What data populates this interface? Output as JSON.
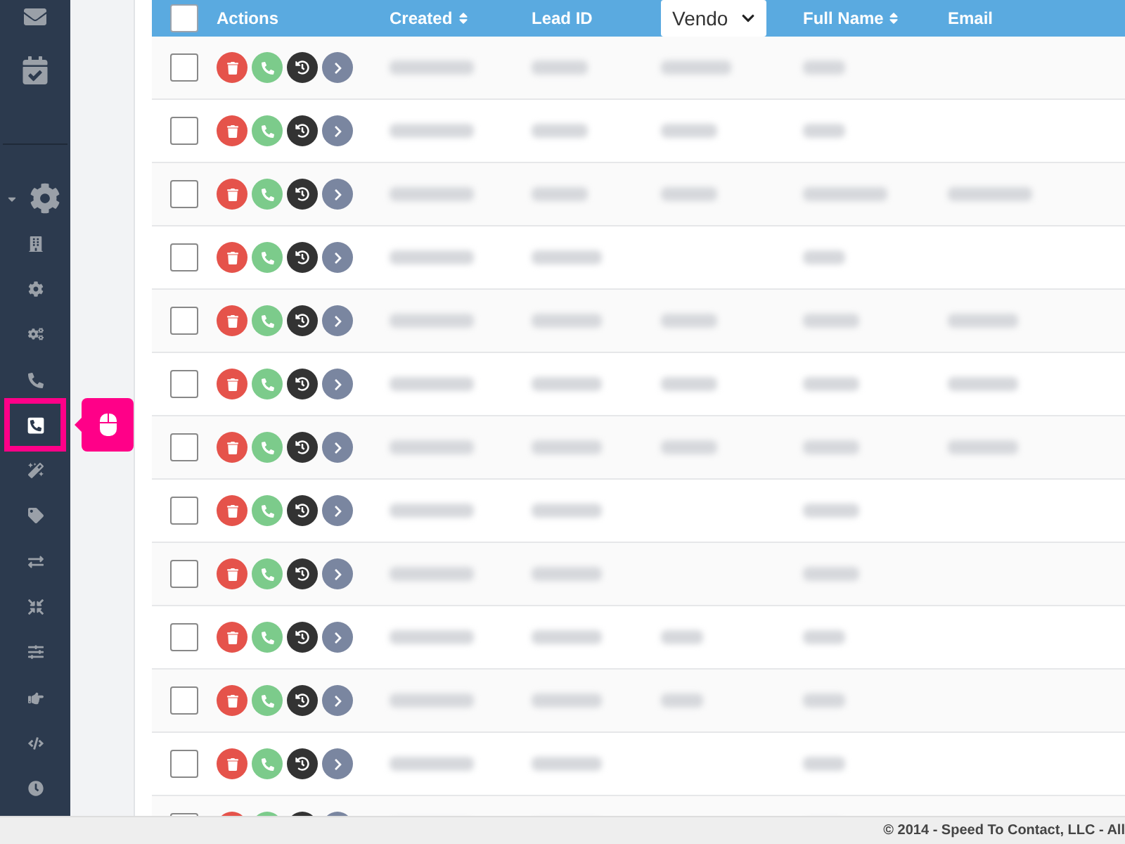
{
  "sidebar": {
    "top_items": [
      {
        "kind": "mail",
        "selected": false
      },
      {
        "kind": "check",
        "selected": false
      }
    ],
    "settings_expanded": true,
    "items": [
      {
        "kind": "building",
        "selected": false
      },
      {
        "kind": "cog",
        "selected": false
      },
      {
        "kind": "cogs",
        "selected": false
      },
      {
        "kind": "phone",
        "selected": false
      },
      {
        "kind": "phone-square",
        "selected": true
      },
      {
        "kind": "magic",
        "selected": false
      },
      {
        "kind": "tag",
        "selected": false
      },
      {
        "kind": "exchange",
        "selected": false
      },
      {
        "kind": "compress",
        "selected": false
      },
      {
        "kind": "sliders",
        "selected": false
      },
      {
        "kind": "hand",
        "selected": false
      },
      {
        "kind": "code",
        "selected": false
      },
      {
        "kind": "clock",
        "selected": false
      }
    ]
  },
  "table": {
    "header_checked": false,
    "columns": [
      {
        "label": "Actions",
        "sortable": false
      },
      {
        "label": "Created",
        "sortable": true
      },
      {
        "label": "Lead ID",
        "sortable": false
      },
      {
        "kind": "select",
        "value": "Vendo"
      },
      {
        "label": "Full Name",
        "sortable": true
      },
      {
        "label": "Email",
        "sortable": false
      }
    ],
    "rows": [
      {
        "checked": false
      },
      {
        "checked": false
      },
      {
        "checked": false
      },
      {
        "checked": false
      },
      {
        "checked": false
      },
      {
        "checked": false
      },
      {
        "checked": false
      },
      {
        "checked": false
      },
      {
        "checked": false
      },
      {
        "checked": false
      },
      {
        "checked": false
      },
      {
        "checked": false
      },
      {
        "checked": false
      }
    ]
  },
  "footer": {
    "text": "© 2014 - Speed To Contact, LLC - All"
  }
}
